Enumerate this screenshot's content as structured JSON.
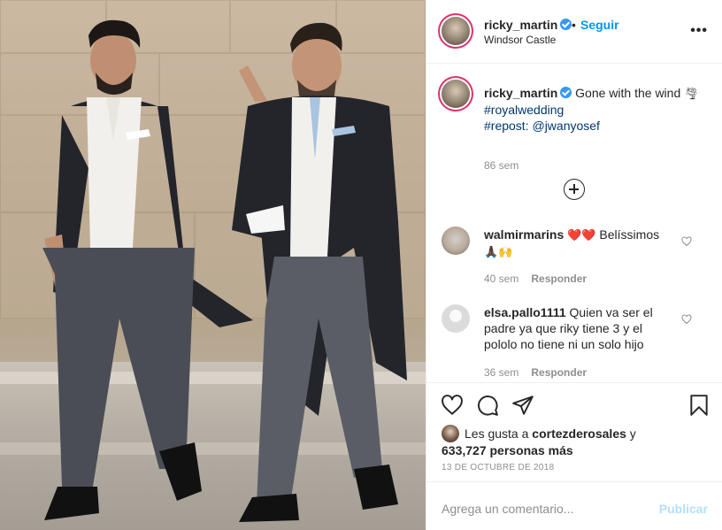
{
  "post": {
    "image_alt": "Two men in morning suits walking outside Windsor Castle"
  },
  "header": {
    "username": "ricky_martin",
    "separator": "•",
    "follow_label": "Seguir",
    "location": "Windsor Castle",
    "more_icon": "more-horizontal-icon",
    "more_glyph": "•••"
  },
  "caption": {
    "username": "ricky_martin",
    "text": "Gone with the wind",
    "emoji": "🌪",
    "tags": [
      "#royalwedding",
      "#repost: @jwanyosef"
    ],
    "time": "86 sem"
  },
  "load_more_icon": "plus-circle-icon",
  "comments": [
    {
      "username": "walmirmarins",
      "text_emoji_1": "❤️",
      "text_emoji_2": "❤️",
      "text": "Belíssimos",
      "text_emoji_3": "🙏🏿",
      "text_emoji_4": "🙌",
      "time": "40 sem",
      "reply_label": "Responder"
    },
    {
      "username": "elsa.pallo1111",
      "text": "Quien va ser el padre ya que riky tiene 3 y el pololo no tiene ni un solo hijo",
      "time": "36 sem",
      "reply_label": "Responder"
    }
  ],
  "actions": {
    "like_icon": "heart-icon",
    "comment_icon": "comment-icon",
    "share_icon": "send-icon",
    "save_icon": "bookmark-icon"
  },
  "likes": {
    "prefix": "Les gusta a",
    "user": "cortezderosales",
    "conj": "y",
    "count": "633,727 personas más"
  },
  "date": "13 DE OCTUBRE DE 2018",
  "add_comment": {
    "placeholder": "Agrega un comentario...",
    "post_label": "Publicar"
  },
  "colors": {
    "link_blue": "#0095f6",
    "hashtag": "#00376b",
    "secondary_text": "#8e8e8e",
    "story_ring": "#e0306d",
    "verified": "#3897f0",
    "heart_red": "#ed4956"
  }
}
